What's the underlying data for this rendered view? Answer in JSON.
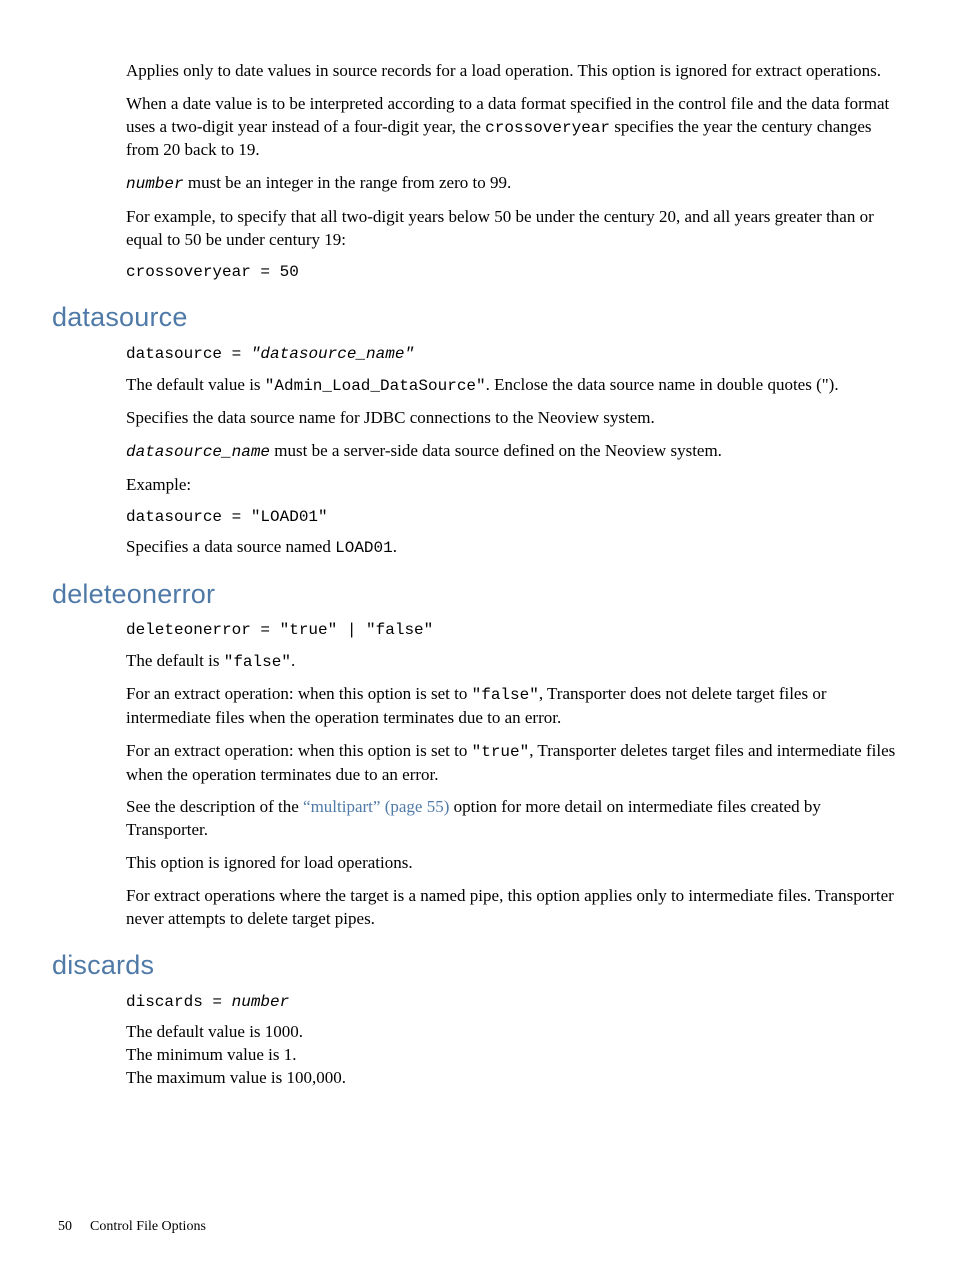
{
  "intro": {
    "p1": "Applies only to date values in source records for a load operation. This option is ignored for extract operations.",
    "p2a": "When a date value is to be interpreted according to a data format specified in the control file and the data format uses a two-digit year instead of a four-digit year, the ",
    "p2code": "crossoveryear",
    "p2b": " specifies the year the century changes from 20 back to 19.",
    "p3var": "number",
    "p3rest": " must be an integer in the range from zero to 99.",
    "p4": "For example, to specify that all two-digit years below 50 be under the century 20, and all years greater than or equal to 50 be under century 19:",
    "code": "crossoveryear = 50"
  },
  "datasource": {
    "heading": "datasource",
    "syntax_a": "datasource = ",
    "syntax_b": "\"datasource_name\"",
    "p1a": "The default value is ",
    "p1code": "\"Admin_Load_DataSource\"",
    "p1b": ". Enclose the data source name in double quotes (\").",
    "p2": "Specifies the data source name for JDBC connections to the Neoview system.",
    "p3var": "datasource_name",
    "p3rest": " must be a server-side data source defined on the Neoview system.",
    "p4": "Example:",
    "code": "datasource = \"LOAD01\"",
    "p5a": "Specifies a data source named ",
    "p5code": "LOAD01",
    "p5b": "."
  },
  "deleteonerror": {
    "heading": "deleteonerror",
    "syntax": "deleteonerror = \"true\" | \"false\"",
    "p1a": "The default is ",
    "p1code": "\"false\"",
    "p1b": ".",
    "p2a": "For an extract operation: when this option is set to ",
    "p2code": "\"false\"",
    "p2b": ", Transporter does not delete target files or intermediate files when the operation terminates due to an error.",
    "p3a": "For an extract operation: when this option is set to ",
    "p3code": "\"true\"",
    "p3b": ", Transporter deletes target files and intermediate files when the operation terminates due to an error.",
    "p4a": "See the description of the ",
    "p4link": "“multipart” (page 55)",
    "p4b": " option for more detail on intermediate files created by Transporter.",
    "p5": "This option is ignored for load operations.",
    "p6": "For extract operations where the target is a named pipe, this option applies only to intermediate files. Transporter never attempts to delete target pipes."
  },
  "discards": {
    "heading": "discards",
    "syntax_a": "discards = ",
    "syntax_b": "number",
    "l1": "The default value is 1000.",
    "l2": "The minimum value is 1.",
    "l3": "The maximum value is 100,000."
  },
  "footer": {
    "page": "50",
    "title": "Control File Options"
  }
}
